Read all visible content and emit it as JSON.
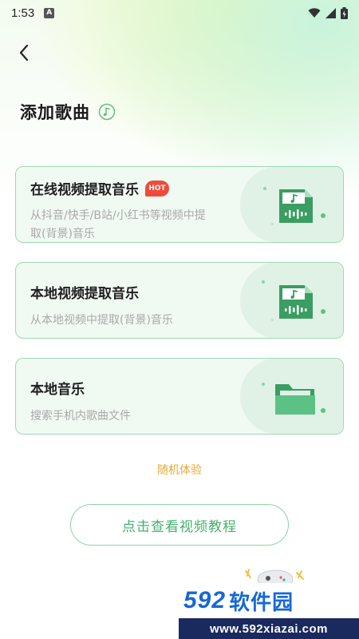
{
  "status_bar": {
    "time": "1:53",
    "notification_letter": "A"
  },
  "header": {
    "title": "添加歌曲"
  },
  "cards": [
    {
      "title": "在线视频提取音乐",
      "badge": "HOT",
      "description_line1": "从抖音/快手/B站/小红书等视频中提",
      "description_line2": "取(背景)音乐",
      "icon": "music-file-icon"
    },
    {
      "title": "本地视频提取音乐",
      "description_line1": "从本地视频中提取(背景)音乐",
      "icon": "music-file-icon"
    },
    {
      "title": "本地音乐",
      "description_line1": "搜索手机内歌曲文件",
      "icon": "folder-icon"
    }
  ],
  "random_link": "随机体验",
  "tutorial_button": "点击查看视频教程",
  "watermark": {
    "number": "592",
    "brand": "软件园",
    "url": "www.592xiazai.com"
  },
  "colors": {
    "accent_green": "#45b06d",
    "card_border": "#9ed8b4",
    "random_link": "#e9a83b",
    "hot_badge": "#ef4b3c"
  }
}
